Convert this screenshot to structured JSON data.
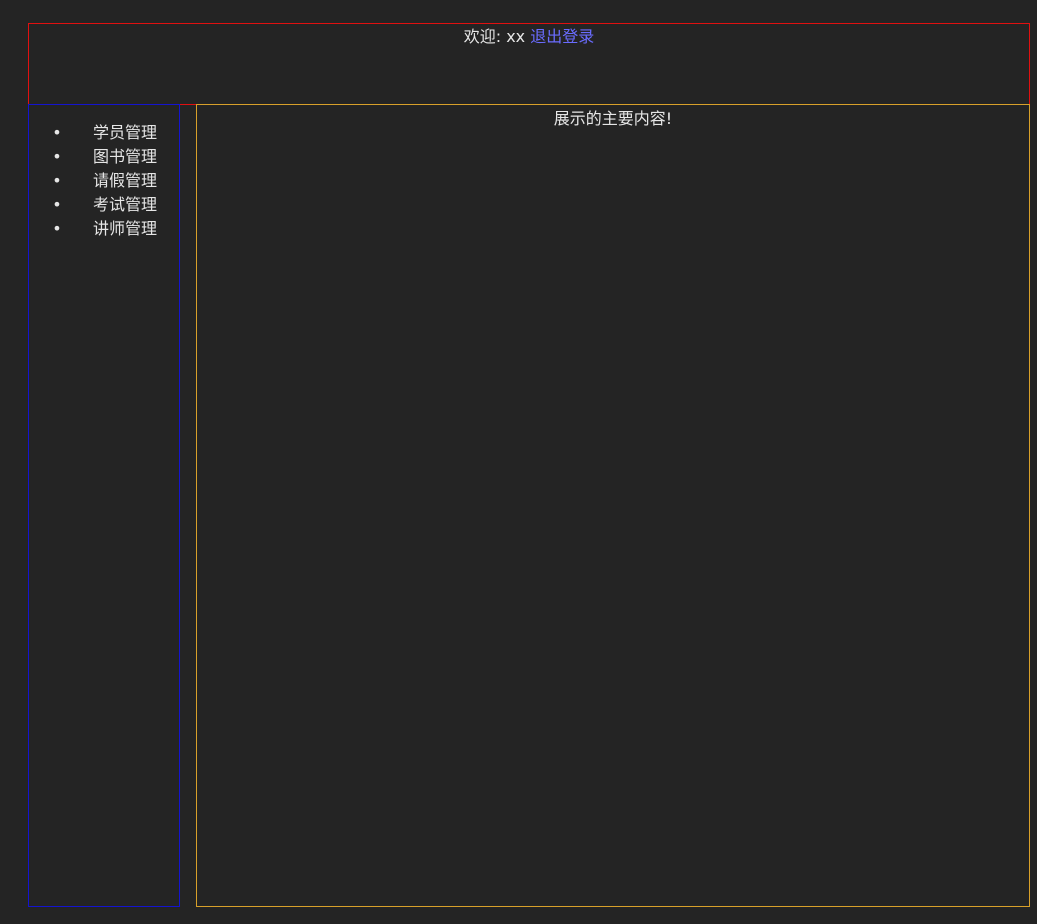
{
  "header": {
    "welcome_prefix": "欢迎: xx",
    "logout_label": "退出登录"
  },
  "sidebar": {
    "items": [
      {
        "label": "学员管理"
      },
      {
        "label": "图书管理"
      },
      {
        "label": "请假管理"
      },
      {
        "label": "考试管理"
      },
      {
        "label": "讲师管理"
      }
    ]
  },
  "main": {
    "content_text": "展示的主要内容!"
  },
  "colors": {
    "background": "#242424",
    "header_border": "#e01010",
    "sidebar_border": "#1414d0",
    "main_border": "#d8a02a",
    "link": "#6a6cff"
  }
}
